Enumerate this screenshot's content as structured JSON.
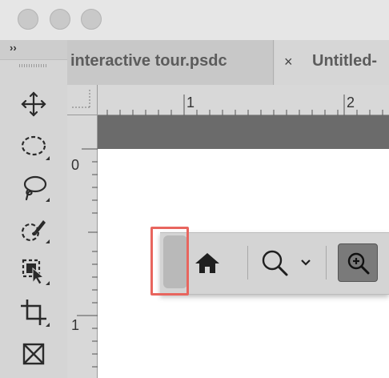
{
  "window": {
    "traffic_lights": [
      "close-button",
      "minimize-button",
      "zoom-button"
    ]
  },
  "toolbar": {
    "collapse_label": "››",
    "tools": [
      {
        "name": "move-tool",
        "icon": "move-icon"
      },
      {
        "name": "marquee-tool",
        "icon": "elliptical-marquee-icon"
      },
      {
        "name": "lasso-tool",
        "icon": "lasso-icon"
      },
      {
        "name": "quick-selection-tool",
        "icon": "quick-selection-brush-icon"
      },
      {
        "name": "object-selection-tool",
        "icon": "object-selection-icon"
      },
      {
        "name": "crop-tool",
        "icon": "crop-icon"
      },
      {
        "name": "frame-tool",
        "icon": "frame-icon"
      }
    ]
  },
  "tabs": [
    {
      "label": "interactive tour.psdc",
      "active": true
    },
    {
      "label": "Untitled-",
      "close": "×",
      "active": false
    }
  ],
  "rulers": {
    "horizontal": [
      "1",
      "2"
    ],
    "vertical": [
      "0",
      "1"
    ]
  },
  "floating_bar": {
    "buttons": [
      {
        "name": "home-button",
        "icon": "home-icon"
      },
      {
        "name": "zoom-tool-dropdown",
        "icon": "magnifier-icon",
        "dropdown": "chevron-down-icon"
      },
      {
        "name": "zoom-in-button",
        "icon": "zoom-in-icon",
        "active": true
      }
    ]
  },
  "colors": {
    "highlight": "#e8655e",
    "canvas_band": "#6b6b6b",
    "canvas": "#ffffff"
  }
}
